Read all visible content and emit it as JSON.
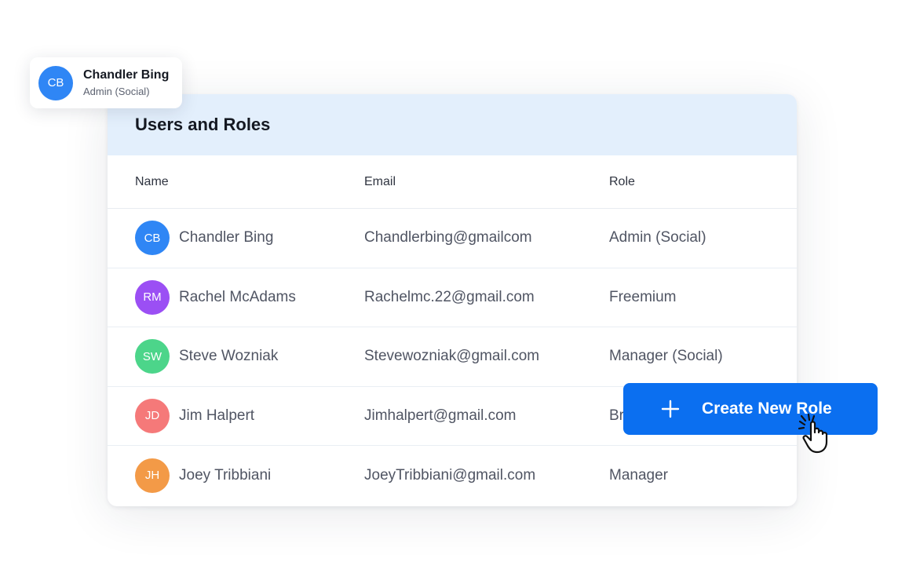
{
  "profile": {
    "initials": "CB",
    "name": "Chandler Bing",
    "role": "Admin (Social)",
    "color": "#2f86f5"
  },
  "card": {
    "title": "Users and Roles"
  },
  "table": {
    "headers": {
      "name": "Name",
      "email": "Email",
      "role": "Role"
    },
    "rows": [
      {
        "initials": "CB",
        "name": "Chandler Bing",
        "email": "Chandlerbing@gmailcom",
        "role": "Admin (Social)",
        "color": "#2f86f5"
      },
      {
        "initials": "RM",
        "name": "Rachel McAdams",
        "email": "Rachelmc.22@gmail.com",
        "role": "Freemium",
        "color": "#9b4ff4"
      },
      {
        "initials": "SW",
        "name": "Steve Wozniak",
        "email": "Stevewozniak@gmail.com",
        "role": "Manager (Social)",
        "color": "#4cd58a"
      },
      {
        "initials": "JD",
        "name": "Jim Halpert",
        "email": "Jimhalpert@gmail.com",
        "role": "Br",
        "color": "#f57979"
      },
      {
        "initials": "JH",
        "name": "Joey Tribbiani",
        "email": "JoeyTribbiani@gmail.com",
        "role": "Manager",
        "color": "#f39a47"
      }
    ]
  },
  "cta": {
    "label": "Create New Role",
    "icon": "plus-icon",
    "color": "#0b6ff0"
  },
  "cursor": {
    "icon": "pointer-hand-icon"
  }
}
